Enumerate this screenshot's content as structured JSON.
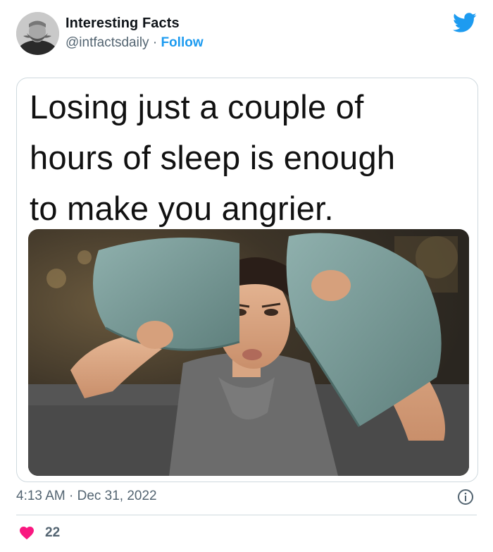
{
  "tweet": {
    "author_name": "Interesting Facts",
    "handle": "@intfactsdaily",
    "separator": "·",
    "follow_label": "Follow",
    "timestamp": "4:13 AM · Dec 31, 2022",
    "like_count": "22"
  },
  "media": {
    "caption_text": "Losing just a couple of\nhours of sleep is enough\nto make you angrier."
  },
  "colors": {
    "accent": "#1d9bf0",
    "like": "#f91880",
    "muted": "#536471",
    "border": "#cfd9de"
  },
  "icons": [
    "twitter-logo-icon",
    "info-icon",
    "heart-icon",
    "user-icon"
  ]
}
